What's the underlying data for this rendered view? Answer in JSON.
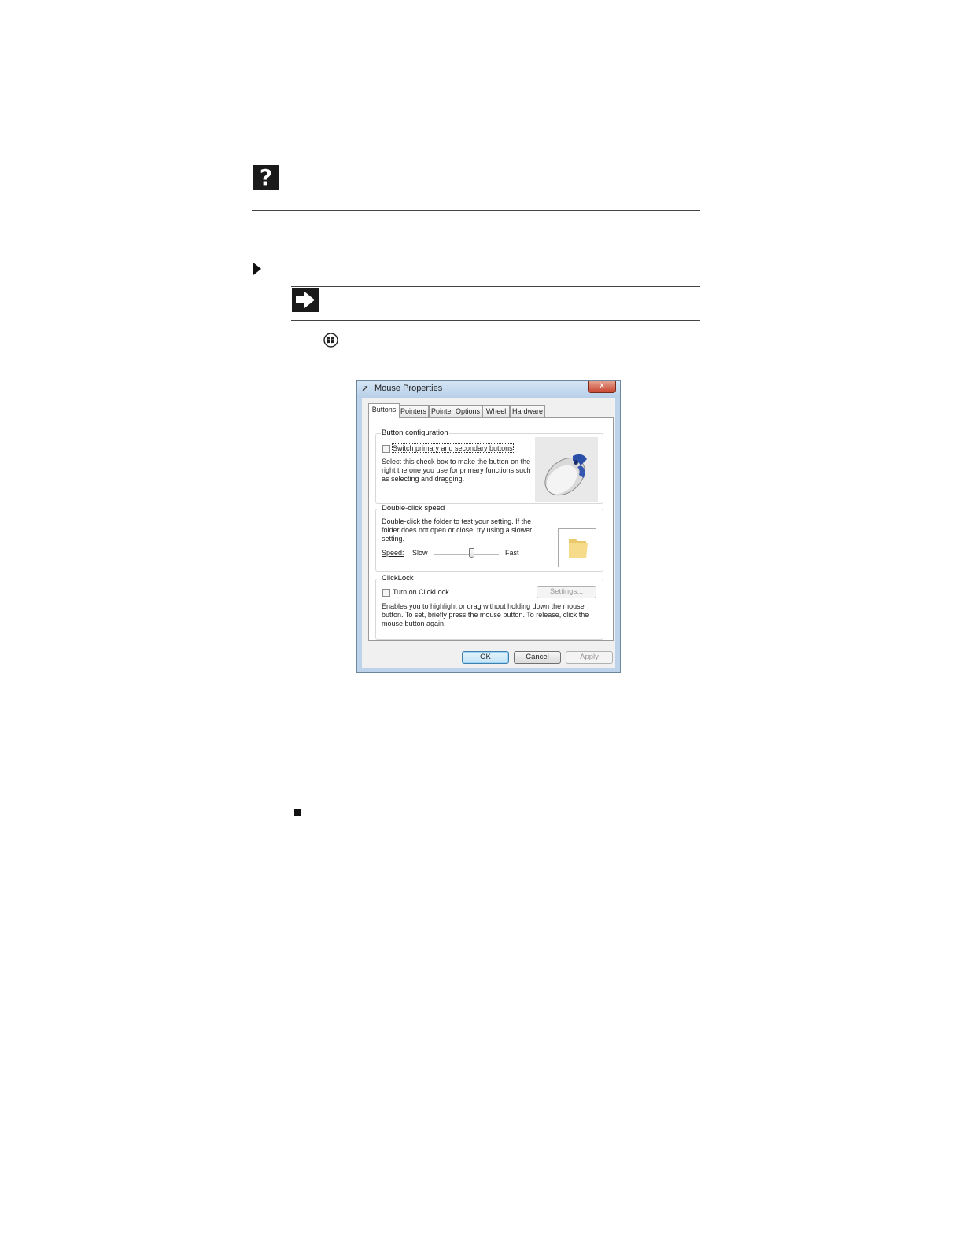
{
  "page": {
    "icons": {
      "help": "help-question-icon",
      "section": "triangle-bullet-icon",
      "shortcut": "arrow-right-icon",
      "start": "windows-start-icon",
      "end": "end-square-icon"
    }
  },
  "dialog": {
    "title": "Mouse Properties",
    "close_label": "x",
    "tabs": [
      {
        "label": "Buttons",
        "active": true
      },
      {
        "label": "Pointers"
      },
      {
        "label": "Pointer Options"
      },
      {
        "label": "Wheel"
      },
      {
        "label": "Hardware"
      }
    ],
    "button_configuration": {
      "legend": "Button configuration",
      "checkbox_label": "Switch primary and secondary buttons",
      "checked": false,
      "description_lines": [
        "Select this check box to make the button on the",
        "right the one you use for primary functions such",
        "as selecting and dragging."
      ]
    },
    "double_click": {
      "legend": "Double-click speed",
      "description_lines": [
        "Double-click the folder to test your setting. If the",
        "folder does not open or close, try using a slower",
        "setting."
      ],
      "speed_label": "Speed:",
      "slow_label": "Slow",
      "fast_label": "Fast",
      "speed_value": 0.58
    },
    "clicklock": {
      "legend": "ClickLock",
      "checkbox_label": "Turn on ClickLock",
      "checked": false,
      "settings_label": "Settings...",
      "description_lines": [
        "Enables you to highlight or drag without holding down the mouse",
        "button. To set, briefly press the mouse button. To release, click the",
        "mouse button again."
      ]
    },
    "buttons": {
      "ok": "OK",
      "cancel": "Cancel",
      "apply": "Apply"
    },
    "colors": {
      "accent": "#3c7fb1",
      "titlebar": "#b8d0e8",
      "close": "#c8452f"
    }
  }
}
